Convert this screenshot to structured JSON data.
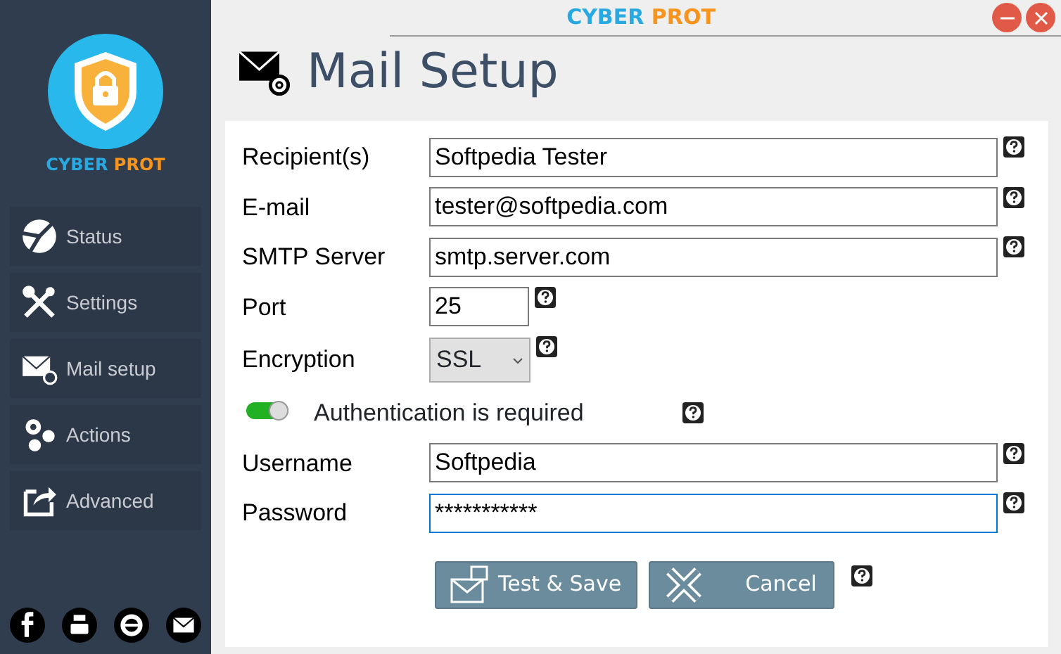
{
  "sidebar": {
    "logo_text": {
      "first": "CYBER",
      "second": "PROT"
    },
    "items": [
      {
        "label": "Status"
      },
      {
        "label": "Settings"
      },
      {
        "label": "Mail setup"
      },
      {
        "label": "Actions"
      },
      {
        "label": "Advanced"
      }
    ]
  },
  "window": {
    "title": {
      "first": "CYBER",
      "second": "PROT"
    }
  },
  "heading": "Mail Setup",
  "fields": [
    {
      "kind": "text",
      "label": "Recipient(s)",
      "value": "Softpedia Tester",
      "focused": false
    },
    {
      "kind": "text",
      "label": "E-mail",
      "value": "tester@softpedia.com",
      "focused": false
    },
    {
      "kind": "text",
      "label": "SMTP Server",
      "value": "smtp.server.com",
      "focused": false
    },
    {
      "kind": "short",
      "label": "Port",
      "value": "25",
      "focused": false
    },
    {
      "kind": "select",
      "label": "Encryption",
      "value": "SSL"
    },
    {
      "kind": "toggle",
      "label": "Authentication is required",
      "on": true
    },
    {
      "kind": "text",
      "label": "Username",
      "value": "Softpedia",
      "focused": false
    },
    {
      "kind": "text",
      "label": "Password",
      "value": "***********",
      "focused": true
    }
  ],
  "buttons": [
    {
      "label": "Test & Save"
    },
    {
      "label": "Cancel"
    }
  ]
}
